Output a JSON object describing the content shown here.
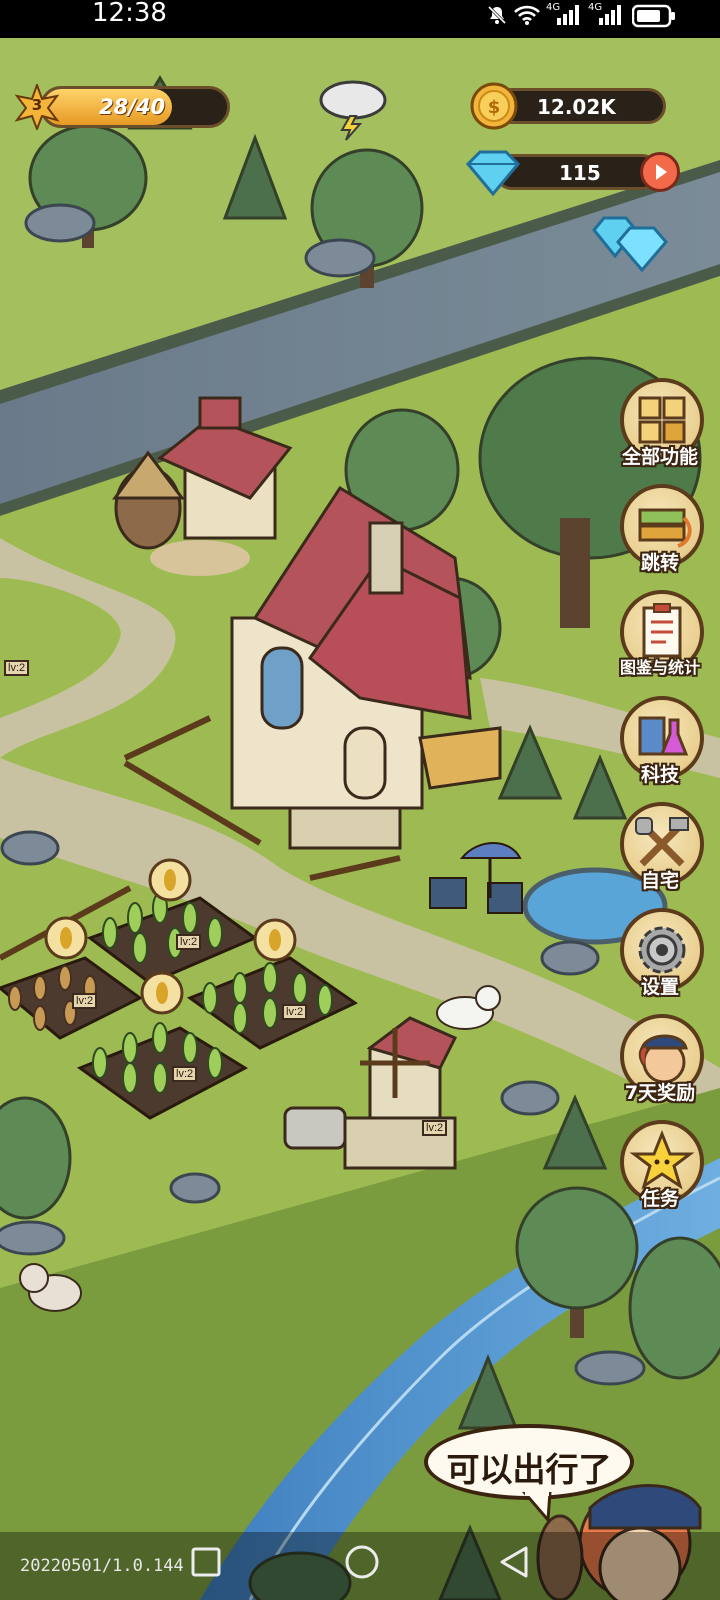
{
  "status_bar": {
    "time": "12:38",
    "icons": [
      "mute-icon",
      "wifi-icon",
      "signal-4g-icon",
      "signal-4g-icon",
      "battery-icon"
    ],
    "network_label_1": "4G",
    "network_label_2": "4G"
  },
  "hud": {
    "level": "3",
    "energy": "28/40",
    "energy_fraction": 0.7,
    "coins": "12.02K",
    "gems": "115",
    "weather_icon": "thunderstorm-icon"
  },
  "side_menu": [
    {
      "label": "全部功能",
      "icon": "all-functions-icon"
    },
    {
      "label": "跳转",
      "icon": "jump-icon"
    },
    {
      "label": "图鉴与统计",
      "icon": "catalog-stats-icon"
    },
    {
      "label": "科技",
      "icon": "technology-icon"
    },
    {
      "label": "自宅",
      "icon": "home-tools-icon"
    },
    {
      "label": "设置",
      "icon": "settings-gear-icon"
    },
    {
      "label": "7天奖励",
      "icon": "seven-day-reward-icon"
    },
    {
      "label": "任务",
      "icon": "quest-star-icon"
    }
  ],
  "field_signs": {
    "sign_1": "lv:2",
    "sign_2": "lv:2",
    "sign_3": "lv:2",
    "sign_4": "lv:2",
    "sign_5": "lv:2",
    "sign_6": "lv:2"
  },
  "speech_bubble": "可以出行了",
  "version": "20220501/1.0.144",
  "nav": {
    "recent_icon": "square-icon",
    "home_icon": "circle-icon",
    "back_icon": "triangle-back-icon"
  },
  "colors": {
    "grass": "#8db452",
    "road": "#c9c2a2",
    "river_top": "#6f7f8f",
    "river_bottom": "#4f8fcf",
    "hud_gold": "#f3b43a",
    "roof_red": "#b4545a"
  }
}
